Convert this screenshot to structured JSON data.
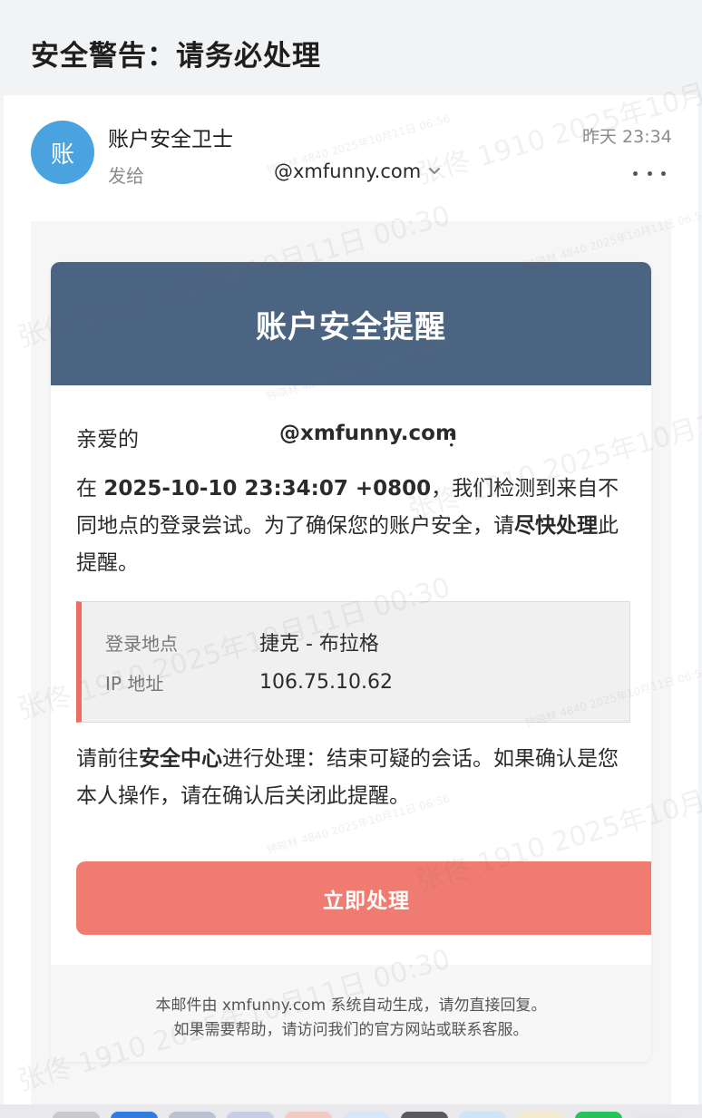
{
  "subject": "安全警告：请务必处理",
  "sender": {
    "avatar_char": "账",
    "name": "账户安全卫士",
    "sent_to_label": "发给",
    "recipient": "@xmfunny.com",
    "time": "昨天 23:34"
  },
  "email": {
    "header_title": "账户安全提醒",
    "greeting": "亲爱的",
    "greeting_email": "@xmfunny.com",
    "greeting_colon": "：",
    "para1": {
      "prefix": "在 ",
      "datetime": "2025-10-10 23:34:07 +0800",
      "middle": "，我们检测到来自不同地点的登录尝试。为了确保您的账户安全，请",
      "emphasis": "尽快处理",
      "suffix": "此提醒。"
    },
    "info": {
      "location_label": "登录地点",
      "location_value": "捷克 - 布拉格",
      "ip_label": "IP 地址",
      "ip_value": "106.75.10.62"
    },
    "para2": {
      "prefix": "请前往",
      "emphasis": "安全中心",
      "suffix": "进行处理：结束可疑的会话。如果确认是您本人操作，请在确认后关闭此提醒。"
    },
    "button_label": "立即处理",
    "footer_line1": "本邮件由 xmfunny.com 系统自动生成，请勿直接回复。",
    "footer_line2": "如果需要帮助，请访问我们的官方网站或联系客服。"
  },
  "watermark": {
    "primary": "张佟 1910 2025年10月11日 00:30",
    "secondary": "钟晓林 4840 2025年10月11日 06:56"
  },
  "colors": {
    "header_bg": "#4a6481",
    "button_bg": "#f07b70",
    "info_accent": "#ef6b63",
    "avatar_bg": "#4aa3df"
  },
  "icons": {
    "recipient_expand": "chevron-down-icon",
    "more": "more-horizontal-icon"
  }
}
